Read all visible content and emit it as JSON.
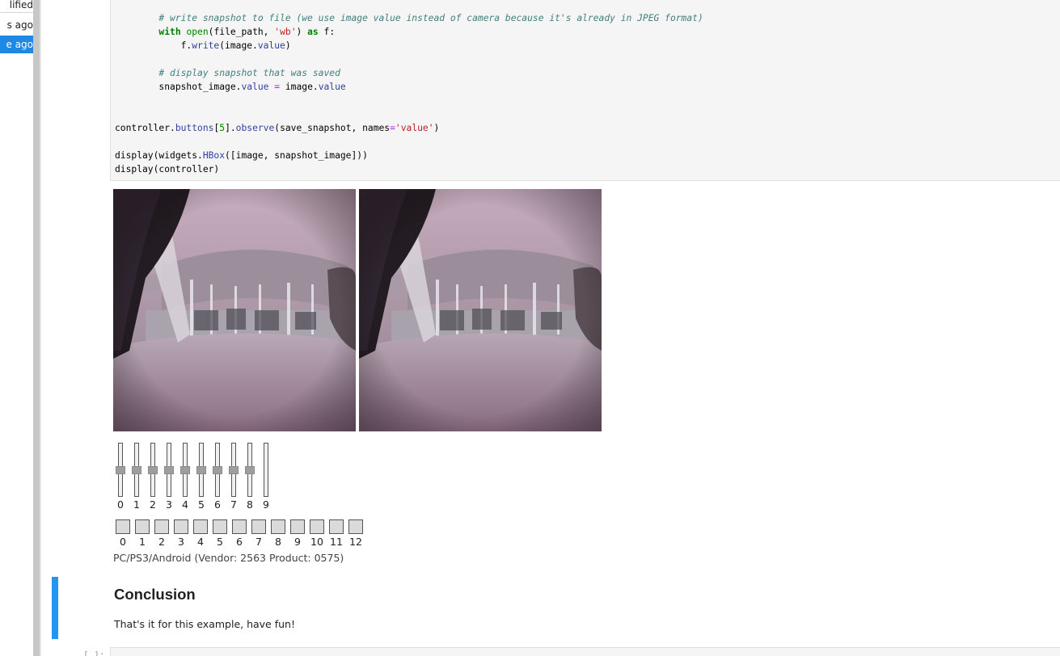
{
  "file_browser": {
    "header": "lified",
    "rows": [
      {
        "text": "s ago",
        "selected": false
      },
      {
        "text": "e ago",
        "selected": true
      }
    ]
  },
  "code_cell": {
    "lines": [
      [
        {
          "t": "        "
        },
        {
          "t": "# write snapshot to file (we use image value instead of camera because it's already in JPEG format)",
          "c": "comment"
        }
      ],
      [
        {
          "t": "        "
        },
        {
          "t": "with",
          "c": "keyword"
        },
        {
          "t": " "
        },
        {
          "t": "open",
          "c": "builtin"
        },
        {
          "t": "(file_path, "
        },
        {
          "t": "'wb'",
          "c": "string"
        },
        {
          "t": ") "
        },
        {
          "t": "as",
          "c": "keyword"
        },
        {
          "t": " f:"
        }
      ],
      [
        {
          "t": "            f."
        },
        {
          "t": "write",
          "c": "prop"
        },
        {
          "t": "(image."
        },
        {
          "t": "value",
          "c": "prop"
        },
        {
          "t": ")"
        }
      ],
      [
        {
          "t": ""
        }
      ],
      [
        {
          "t": "        "
        },
        {
          "t": "# display snapshot that was saved",
          "c": "comment"
        }
      ],
      [
        {
          "t": "        snapshot_image."
        },
        {
          "t": "value",
          "c": "prop"
        },
        {
          "t": " "
        },
        {
          "t": "=",
          "c": "op"
        },
        {
          "t": " image."
        },
        {
          "t": "value",
          "c": "prop"
        }
      ],
      [
        {
          "t": ""
        }
      ],
      [
        {
          "t": ""
        }
      ],
      [
        {
          "t": "controller."
        },
        {
          "t": "buttons",
          "c": "prop"
        },
        {
          "t": "["
        },
        {
          "t": "5",
          "c": "num"
        },
        {
          "t": "]."
        },
        {
          "t": "observe",
          "c": "prop"
        },
        {
          "t": "(save_snapshot, names"
        },
        {
          "t": "=",
          "c": "op"
        },
        {
          "t": "'value'",
          "c": "string"
        },
        {
          "t": ")"
        }
      ],
      [
        {
          "t": ""
        }
      ],
      [
        {
          "t": "display(widgets."
        },
        {
          "t": "HBox",
          "c": "prop"
        },
        {
          "t": "([image, snapshot_image]))"
        }
      ],
      [
        {
          "t": "display(controller)"
        }
      ]
    ]
  },
  "controller": {
    "axes": [
      {
        "label": "0",
        "value": 0.0
      },
      {
        "label": "1",
        "value": 0.0
      },
      {
        "label": "2",
        "value": 0.0
      },
      {
        "label": "3",
        "value": 0.0
      },
      {
        "label": "4",
        "value": 0.0
      },
      {
        "label": "5",
        "value": 0.0
      },
      {
        "label": "6",
        "value": 0.0
      },
      {
        "label": "7",
        "value": 0.0
      },
      {
        "label": "8",
        "value": 0.0
      },
      {
        "label": "9",
        "value": null
      }
    ],
    "buttons": [
      "0",
      "1",
      "2",
      "3",
      "4",
      "5",
      "6",
      "7",
      "8",
      "9",
      "10",
      "11",
      "12"
    ],
    "name": "PC/PS3/Android (Vendor: 2563 Product: 0575)"
  },
  "markdown": {
    "title": "Conclusion",
    "text": "That's it for this example, have fun!"
  },
  "next_cell": {
    "prompt": "[ ]:"
  },
  "colors": {
    "accent": "#1e88e5",
    "cell_marker": "#2196f3",
    "code_bg": "#f5f5f5"
  }
}
